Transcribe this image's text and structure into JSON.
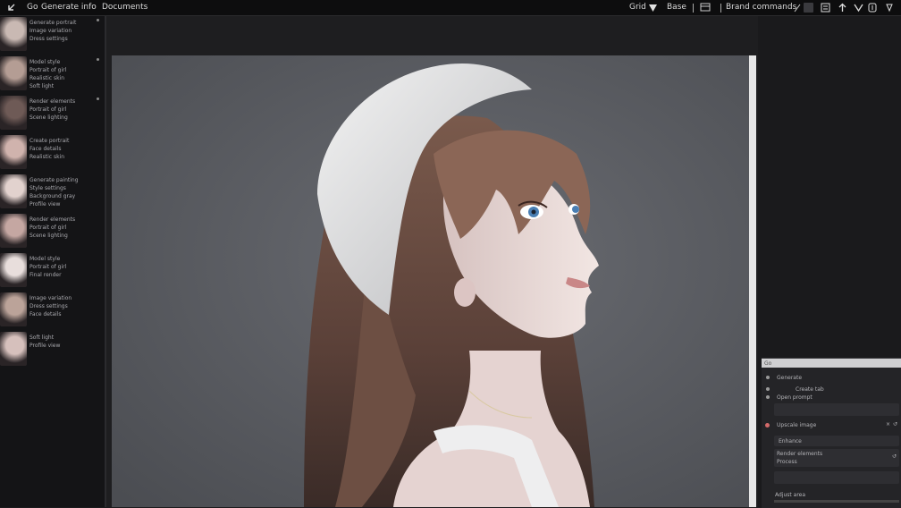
{
  "topbar": {
    "menu1": "Go",
    "menu2": "Generate info",
    "menu3": "Documents",
    "right1": "Grid",
    "right2": "Base",
    "right3": "Brand commands"
  },
  "history": [
    {
      "lines": [
        "Generate portrait",
        "Image variation",
        "Dress settings"
      ]
    },
    {
      "lines": [
        "Model style",
        "Portrait of girl",
        "Realistic skin",
        "Soft light"
      ]
    },
    {
      "lines": [
        "Render elements",
        "Portrait of girl",
        "Scene lighting"
      ]
    },
    {
      "lines": [
        "Create portrait",
        "Face details",
        "Realistic skin"
      ]
    },
    {
      "lines": [
        "Generate painting",
        "Style settings",
        "Background gray",
        "Profile view"
      ]
    },
    {
      "lines": [
        "Render elements",
        "Portrait of girl",
        "Scene lighting"
      ]
    },
    {
      "lines": [
        "Model style",
        "Portrait of girl",
        "Final render"
      ]
    },
    {
      "lines": [
        "Image variation",
        "Dress settings",
        "Face details"
      ]
    },
    {
      "lines": [
        "Soft light",
        "Profile view"
      ]
    }
  ],
  "dock": {
    "title": "Go",
    "l1": "Generate",
    "l2": "Create tab",
    "l3": "Open prompt",
    "l4": "Upscale image",
    "l5": "Enhance",
    "l6": "Render elements",
    "l7": "Process",
    "l8": "Adjust area"
  },
  "colors": {
    "accent": "#e8e8ea",
    "background": "#1b1b1d",
    "canvas": "#5b5d62"
  }
}
